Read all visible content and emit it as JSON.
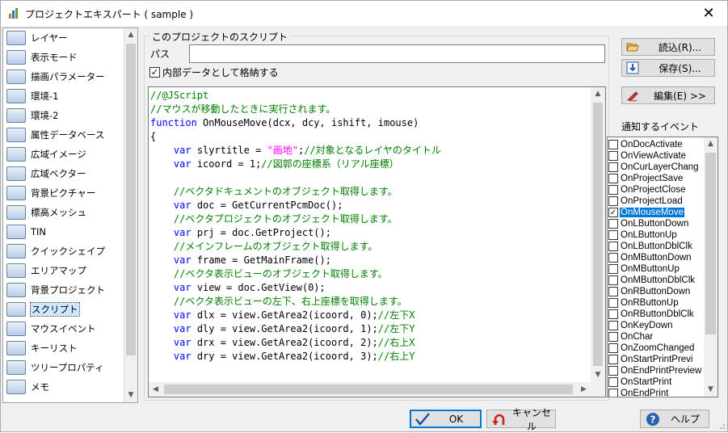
{
  "window": {
    "title": "プロジェクトエキスパート ( sample )",
    "close_glyph": "✕"
  },
  "sidebar": {
    "items": [
      {
        "label": "レイヤー",
        "icon": "layer-icon"
      },
      {
        "label": "表示モード",
        "icon": "display-mode-icon"
      },
      {
        "label": "描画パラメーター",
        "icon": "draw-parameter-icon"
      },
      {
        "label": "環境-1",
        "icon": "environment-icon"
      },
      {
        "label": "環境-2",
        "icon": "environment-icon"
      },
      {
        "label": "属性データベース",
        "icon": "attribute-database-icon"
      },
      {
        "label": "広域イメージ",
        "icon": "wide-image-icon"
      },
      {
        "label": "広域ベクター",
        "icon": "wide-vector-icon"
      },
      {
        "label": "背景ピクチャー",
        "icon": "background-picture-icon"
      },
      {
        "label": "標高メッシュ",
        "icon": "elevation-mesh-icon"
      },
      {
        "label": "TIN",
        "icon": "tin-icon"
      },
      {
        "label": "クイックシェイプ",
        "icon": "quick-shape-icon"
      },
      {
        "label": "エリアマップ",
        "icon": "area-map-icon"
      },
      {
        "label": "背景プロジェクト",
        "icon": "background-project-icon"
      },
      {
        "label": "スクリプト",
        "icon": "script-icon",
        "selected": true
      },
      {
        "label": "マウスイベント",
        "icon": "mouse-icon"
      },
      {
        "label": "キーリスト",
        "icon": "key-list-icon"
      },
      {
        "label": "ツリープロパティ",
        "icon": "tree-property-icon"
      },
      {
        "label": "メモ",
        "icon": "memo-icon"
      }
    ]
  },
  "group": {
    "legend": "このプロジェクトのスクリプト",
    "path_label": "パス",
    "path_value": "",
    "internal_checkbox_label": "内部データとして格納する",
    "internal_checked": true
  },
  "code_lines": [
    [
      [
        "c",
        "//@JScript"
      ]
    ],
    [
      [
        "c",
        "//マウスが移動したときに実行されます。"
      ]
    ],
    [
      [
        "k",
        "function"
      ],
      [
        "t",
        " OnMouseMove(dcx, dcy, ishift, imouse)"
      ]
    ],
    [
      [
        "t",
        "{"
      ]
    ],
    [
      [
        "t",
        "    "
      ],
      [
        "k",
        "var"
      ],
      [
        "t",
        " slyrtitle = "
      ],
      [
        "s",
        "\"画地\""
      ],
      [
        "t",
        ";"
      ],
      [
        "c",
        "//対象となるレイヤのタイトル"
      ]
    ],
    [
      [
        "t",
        "    "
      ],
      [
        "k",
        "var"
      ],
      [
        "t",
        " icoord = 1;"
      ],
      [
        "c",
        "//図郭の座標系（リアル座標）"
      ]
    ],
    [
      [
        "t",
        ""
      ]
    ],
    [
      [
        "t",
        "    "
      ],
      [
        "c",
        "//ベクタドキュメントのオブジェクト取得します。"
      ]
    ],
    [
      [
        "t",
        "    "
      ],
      [
        "k",
        "var"
      ],
      [
        "t",
        " doc = GetCurrentPcmDoc();"
      ]
    ],
    [
      [
        "t",
        "    "
      ],
      [
        "c",
        "//ベクタプロジェクトのオブジェクト取得します。"
      ]
    ],
    [
      [
        "t",
        "    "
      ],
      [
        "k",
        "var"
      ],
      [
        "t",
        " prj = doc.GetProject();"
      ]
    ],
    [
      [
        "t",
        "    "
      ],
      [
        "c",
        "//メインフレームのオブジェクト取得します。"
      ]
    ],
    [
      [
        "t",
        "    "
      ],
      [
        "k",
        "var"
      ],
      [
        "t",
        " frame = GetMainFrame();"
      ]
    ],
    [
      [
        "t",
        "    "
      ],
      [
        "c",
        "//ベクタ表示ビューのオブジェクト取得します。"
      ]
    ],
    [
      [
        "t",
        "    "
      ],
      [
        "k",
        "var"
      ],
      [
        "t",
        " view = doc.GetView(0);"
      ]
    ],
    [
      [
        "t",
        "    "
      ],
      [
        "c",
        "//ベクタ表示ビューの左下、右上座標を取得します。"
      ]
    ],
    [
      [
        "t",
        "    "
      ],
      [
        "k",
        "var"
      ],
      [
        "t",
        " dlx = view.GetArea2(icoord, 0);"
      ],
      [
        "c",
        "//左下X"
      ]
    ],
    [
      [
        "t",
        "    "
      ],
      [
        "k",
        "var"
      ],
      [
        "t",
        " dly = view.GetArea2(icoord, 1);"
      ],
      [
        "c",
        "//左下Y"
      ]
    ],
    [
      [
        "t",
        "    "
      ],
      [
        "k",
        "var"
      ],
      [
        "t",
        " drx = view.GetArea2(icoord, 2);"
      ],
      [
        "c",
        "//右上X"
      ]
    ],
    [
      [
        "t",
        "    "
      ],
      [
        "k",
        "var"
      ],
      [
        "t",
        " dry = view.GetArea2(icoord, 3);"
      ],
      [
        "c",
        "//右上Y"
      ]
    ]
  ],
  "buttons": {
    "load": "読込(R)...",
    "save": "保存(S)...",
    "edit": "編集(E) >>",
    "ok": "OK",
    "cancel": "キャンセル",
    "help": "ヘルプ"
  },
  "events": {
    "label": "通知するイベント",
    "items": [
      {
        "label": "OnDocActivate",
        "checked": false
      },
      {
        "label": "OnViewActivate",
        "checked": false
      },
      {
        "label": "OnCurLayerChang",
        "checked": false
      },
      {
        "label": "OnProjectSave",
        "checked": false
      },
      {
        "label": "OnProjectClose",
        "checked": false
      },
      {
        "label": "OnProjectLoad",
        "checked": false
      },
      {
        "label": "OnMouseMove",
        "checked": true,
        "selected": true
      },
      {
        "label": "OnLButtonDown",
        "checked": false
      },
      {
        "label": "OnLButtonUp",
        "checked": false
      },
      {
        "label": "OnLButtonDblClk",
        "checked": false
      },
      {
        "label": "OnMButtonDown",
        "checked": false
      },
      {
        "label": "OnMButtonUp",
        "checked": false
      },
      {
        "label": "OnMButtonDblClk",
        "checked": false
      },
      {
        "label": "OnRButtonDown",
        "checked": false
      },
      {
        "label": "OnRButtonUp",
        "checked": false
      },
      {
        "label": "OnRButtonDblClk",
        "checked": false
      },
      {
        "label": "OnKeyDown",
        "checked": false
      },
      {
        "label": "OnChar",
        "checked": false
      },
      {
        "label": "OnZoomChanged",
        "checked": false
      },
      {
        "label": "OnStartPrintPrevi",
        "checked": false
      },
      {
        "label": "OnEndPrintPreview",
        "checked": false
      },
      {
        "label": "OnStartPrint",
        "checked": false
      },
      {
        "label": "OnEndPrint",
        "checked": false
      }
    ]
  },
  "colors": {
    "comment": "#008000",
    "keyword": "#0000ff",
    "string": "#ff00ff",
    "selection": "#0078d7"
  }
}
